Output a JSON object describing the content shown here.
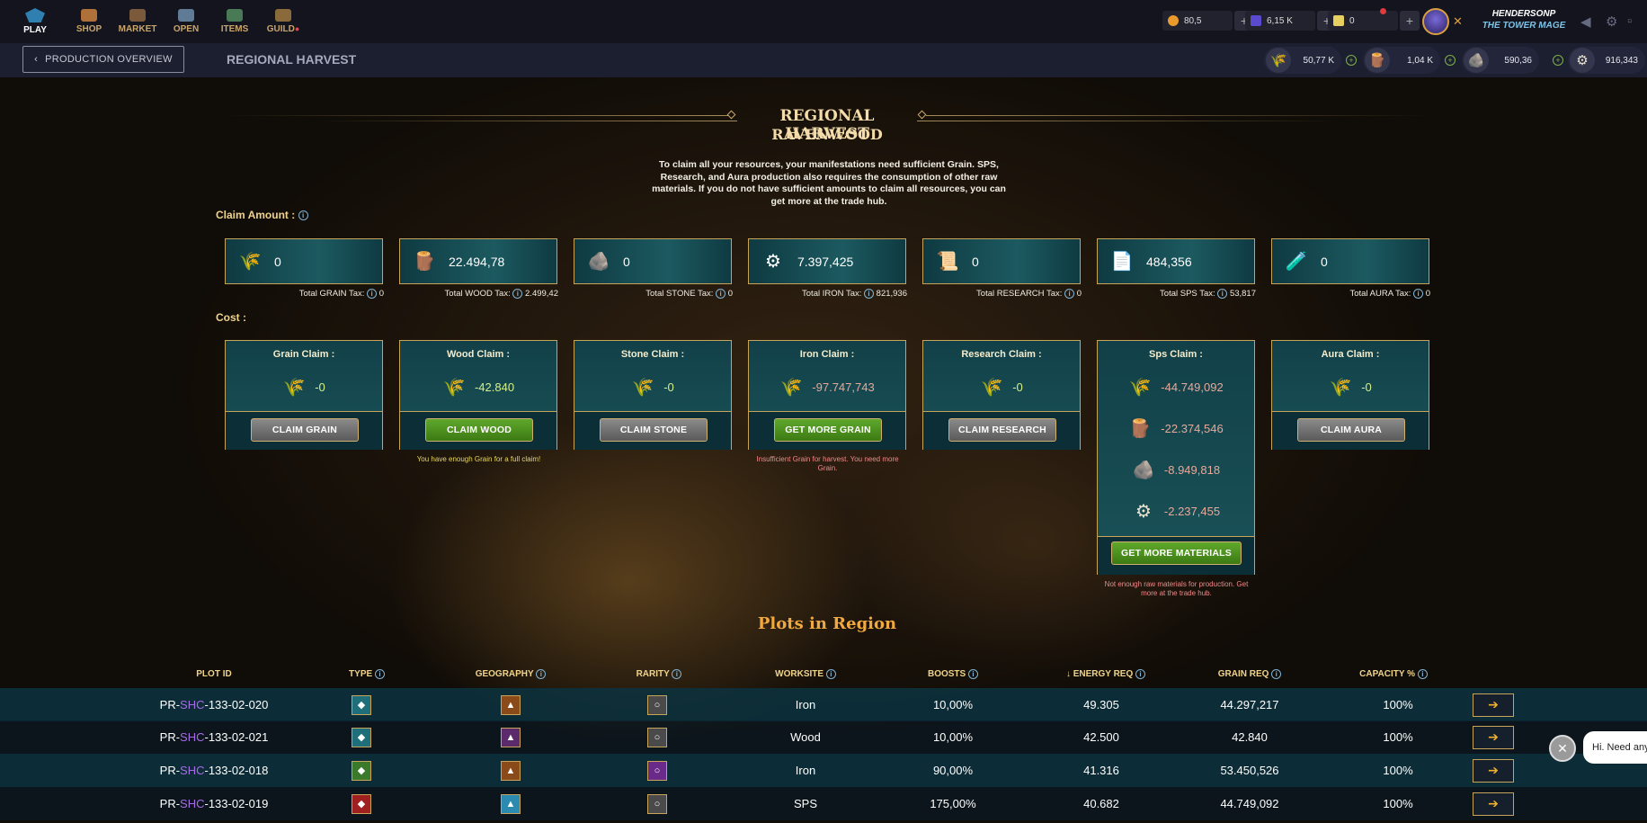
{
  "nav": {
    "items": [
      {
        "label": "PLAY"
      },
      {
        "label": "SHOP"
      },
      {
        "label": "MARKET"
      },
      {
        "label": "OPEN"
      },
      {
        "label": "ITEMS"
      },
      {
        "label": "GUILD"
      }
    ],
    "guild_dot": "●"
  },
  "currencies": {
    "dec": "80,5",
    "sps": "6,15 K",
    "vouchers": "0"
  },
  "user": {
    "name": "HENDERSONP",
    "title": "THE TOWER MAGE"
  },
  "subbar": {
    "back_label": "PRODUCTION OVERVIEW",
    "heading": "REGIONAL HARVEST"
  },
  "resource_chips": [
    {
      "icon": "grain-icon",
      "value": "50,77 K"
    },
    {
      "icon": "wood-icon",
      "value": "1,04 K"
    },
    {
      "icon": "stone-icon",
      "value": "590,36"
    },
    {
      "icon": "iron-icon",
      "value": "916,343"
    }
  ],
  "header": {
    "title": "REGIONAL HARVEST",
    "subtitle": "RAVENWOOD",
    "intro": "To claim all your resources, your manifestations need sufficient Grain. SPS, Research, and Aura production also requires the consumption of other raw materials. If you do not have sufficient amounts to claim all resources, you can get more at the trade hub."
  },
  "claim_amount": {
    "label": "Claim Amount :",
    "items": [
      {
        "icon": "grain-icon",
        "amount": "0",
        "tax_label": "Total GRAIN Tax:",
        "tax": "0"
      },
      {
        "icon": "wood-icon",
        "amount": "22.494,78",
        "tax_label": "Total WOOD Tax:",
        "tax": "2.499,42"
      },
      {
        "icon": "stone-icon",
        "amount": "0",
        "tax_label": "Total STONE Tax:",
        "tax": "0"
      },
      {
        "icon": "iron-icon",
        "amount": "7.397,425",
        "tax_label": "Total IRON Tax:",
        "tax": "821,936"
      },
      {
        "icon": "research-icon",
        "amount": "0",
        "tax_label": "Total RESEARCH Tax:",
        "tax": "0"
      },
      {
        "icon": "sps-icon",
        "amount": "484,356",
        "tax_label": "Total SPS Tax:",
        "tax": "53,817"
      },
      {
        "icon": "aura-icon",
        "amount": "0",
        "tax_label": "Total AURA Tax:",
        "tax": "0"
      }
    ]
  },
  "cost": {
    "label": "Cost :",
    "boxes": [
      {
        "title": "Grain Claim :",
        "value": "-0",
        "button": "CLAIM GRAIN",
        "note": ""
      },
      {
        "title": "Wood Claim :",
        "value": "-42.840",
        "button": "CLAIM WOOD",
        "note": "You have enough Grain for a full claim!"
      },
      {
        "title": "Stone Claim :",
        "value": "-0",
        "button": "CLAIM STONE",
        "note": ""
      },
      {
        "title": "Iron Claim :",
        "value": "-97.747,743",
        "button": "GET MORE GRAIN",
        "note": "Insufficient Grain for harvest. You need more Grain."
      },
      {
        "title": "Research Claim :",
        "value": "-0",
        "button": "CLAIM RESEARCH",
        "note": ""
      },
      {
        "title": "Sps Claim :",
        "values": [
          "-44.749,092",
          "-22.374,546",
          "-8.949,818",
          "-2.237,455"
        ],
        "button": "GET MORE MATERIALS",
        "note": "Not enough raw materials for production. Get more at the trade hub."
      },
      {
        "title": "Aura Claim :",
        "value": "-0",
        "button": "CLAIM AURA",
        "note": ""
      }
    ]
  },
  "plots": {
    "title": "Plots in Region",
    "columns": [
      "PLOT ID",
      "TYPE",
      "GEOGRAPHY",
      "RARITY",
      "WORKSITE",
      "BOOSTS",
      "↓ ENERGY REQ",
      "GRAIN REQ",
      "CAPACITY %"
    ],
    "rows": [
      {
        "id_prefix": "PR-",
        "id_mid": "SHC",
        "id_suffix": "-133-02-020",
        "worksite": "Iron",
        "boosts": "10,00%",
        "energy": "49.305",
        "grain": "44.297,217",
        "capacity": "100%",
        "type_color": "#1f6f7a",
        "geo_color": "#8a4a1a",
        "rarity_color": "#4a4a4a"
      },
      {
        "id_prefix": "PR-",
        "id_mid": "SHC",
        "id_suffix": "-133-02-021",
        "worksite": "Wood",
        "boosts": "10,00%",
        "energy": "42.500",
        "grain": "42.840",
        "capacity": "100%",
        "type_color": "#1f6f7a",
        "geo_color": "#5a2a6a",
        "rarity_color": "#4a4a4a"
      },
      {
        "id_prefix": "PR-",
        "id_mid": "SHC",
        "id_suffix": "-133-02-018",
        "worksite": "Iron",
        "boosts": "90,00%",
        "energy": "41.316",
        "grain": "53.450,526",
        "capacity": "100%",
        "type_color": "#3a7a2a",
        "geo_color": "#8a4a1a",
        "rarity_color": "#6a2a8a"
      },
      {
        "id_prefix": "PR-",
        "id_mid": "SHC",
        "id_suffix": "-133-02-019",
        "worksite": "SPS",
        "boosts": "175,00%",
        "energy": "40.682",
        "grain": "44.749,092",
        "capacity": "100%",
        "type_color": "#a02020",
        "geo_color": "#2a8ab0",
        "rarity_color": "#4a4a4a"
      }
    ]
  },
  "chat": {
    "message": "Hi. Need any"
  }
}
